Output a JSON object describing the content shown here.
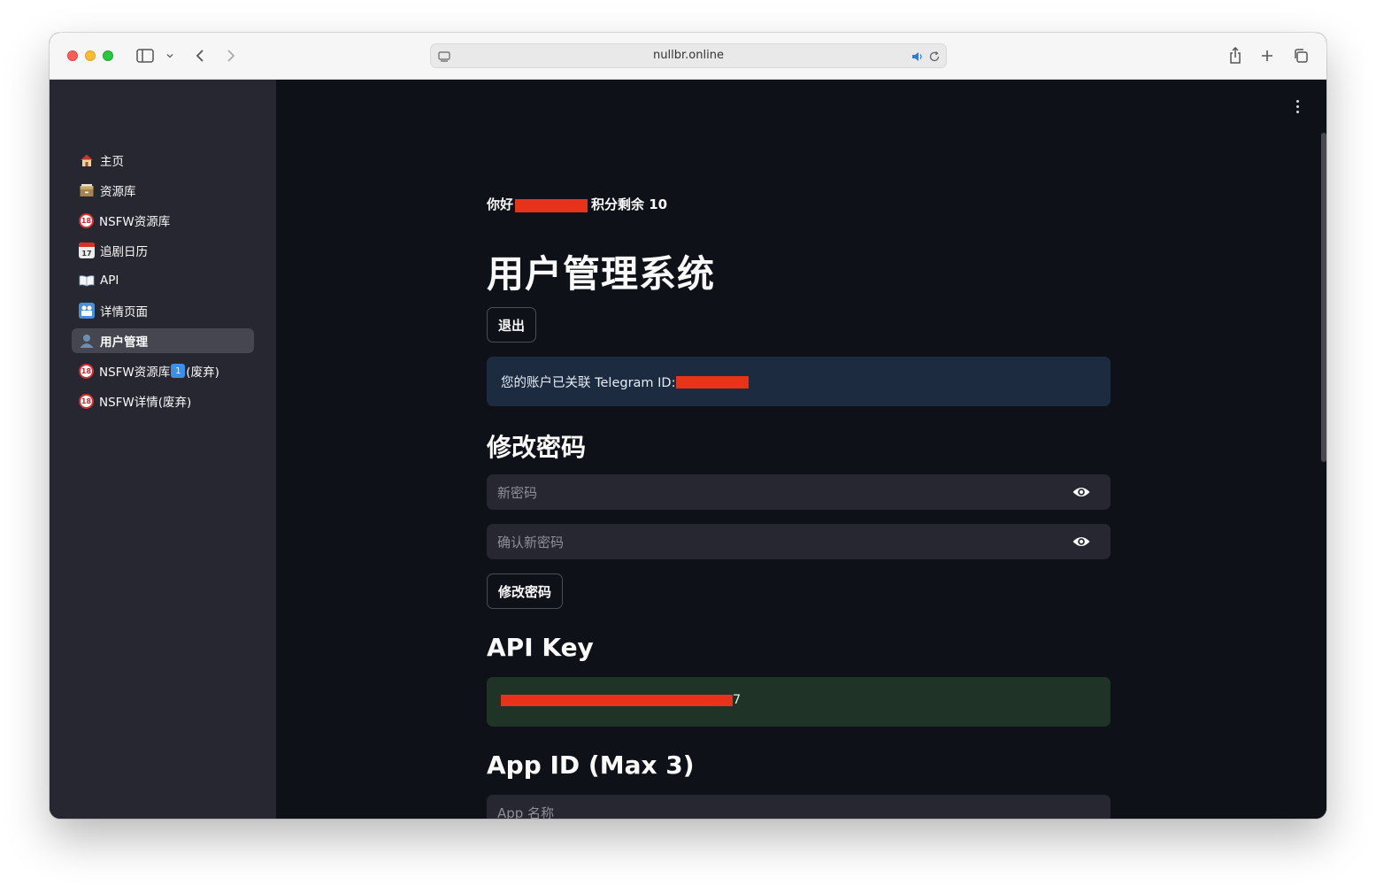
{
  "browser": {
    "url": "nullbr.online"
  },
  "sidebar": {
    "items": [
      {
        "icon": "house-icon",
        "label": "主页",
        "active": false
      },
      {
        "icon": "card-file-box-icon",
        "label": "资源库",
        "active": false
      },
      {
        "icon": "no-one-under-18-icon",
        "label": "NSFW资源库",
        "active": false
      },
      {
        "icon": "calendar-icon",
        "label": "追剧日历",
        "active": false
      },
      {
        "icon": "open-book-icon",
        "label": "API",
        "active": false
      },
      {
        "icon": "film-frames-icon",
        "label": "详情页面",
        "active": false
      },
      {
        "icon": "bust-in-silhouette-icon",
        "label": "用户管理",
        "active": true
      },
      {
        "icon": "no-one-under-18-icon",
        "label": "NSFW资源库",
        "badge": "1",
        "suffix": "(废弃)",
        "active": false
      },
      {
        "icon": "no-one-under-18-icon",
        "label": "NSFW详情(废弃)",
        "active": false
      }
    ],
    "calendar_day": "17",
    "badge_18": "18"
  },
  "main": {
    "greeting_prefix": "你好",
    "greeting_suffix": "积分剩余 10",
    "title": "用户管理系统",
    "logout_label": "退出",
    "telegram_info": "您的账户已关联 Telegram ID:",
    "change_password_heading": "修改密码",
    "new_password_placeholder": "新密码",
    "confirm_password_placeholder": "确认新密码",
    "change_password_button": "修改密码",
    "api_key_heading": "API Key",
    "api_key_tail": "7",
    "app_id_heading": "App ID (Max 3)",
    "app_name_placeholder": "App 名称"
  },
  "colors": {
    "sidebar_bg": "#262730",
    "main_bg": "#0e1117",
    "info_bg": "#1d2b41",
    "success_bg": "#1f3326",
    "redaction": "#e8331b"
  }
}
